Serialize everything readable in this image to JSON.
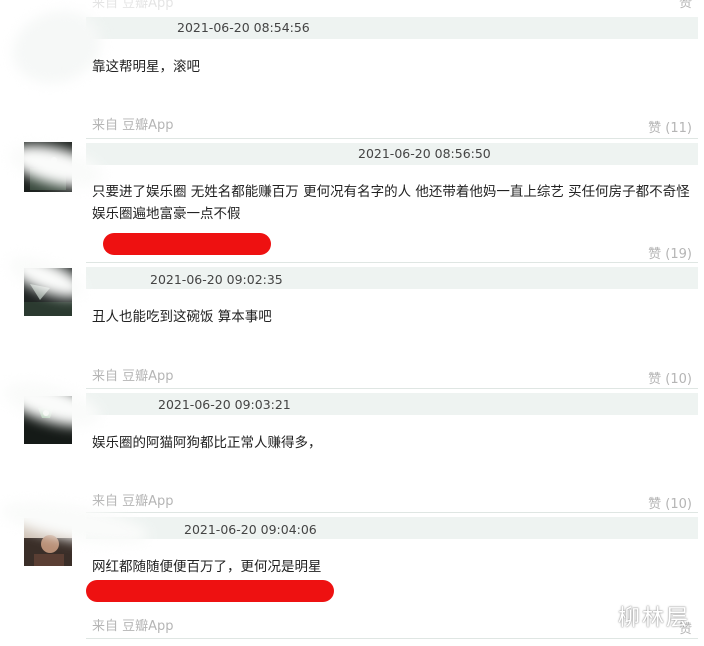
{
  "top_partial": {
    "source": "来自 豆瓣App",
    "likes": "赞"
  },
  "comments": [
    {
      "time": "2021-06-20 08:54:56",
      "text": "靠这帮明星，滚吧",
      "source": "来自 豆瓣App",
      "likes": "赞 (11)"
    },
    {
      "time": "2021-06-20 08:56:50",
      "text": "只要进了娱乐圈 无姓名都能赚百万 更何况有名字的人 他还带着他妈一直上综艺 买任何房子都不奇怪 娱乐圈遍地富豪一点不假",
      "source": "",
      "likes": "赞 (19)"
    },
    {
      "time": "2021-06-20 09:02:35",
      "text": "丑人也能吃到这碗饭 算本事吧",
      "source": "来自 豆瓣App",
      "likes": "赞 (10)"
    },
    {
      "time": "2021-06-20 09:03:21",
      "text": "娱乐圈的阿猫阿狗都比正常人赚得多，",
      "source": "来自 豆瓣App",
      "likes": "赞 (10)"
    },
    {
      "time": "2021-06-20 09:04:06",
      "text": "网红都随随便便百万了，更何况是明星",
      "source": "来自 豆瓣App",
      "likes": "赞"
    }
  ],
  "watermark": "柳林层",
  "colors": {
    "redaction": "#ee1111",
    "header_bg": "#eef3f1",
    "muted": "#b5b5b5"
  }
}
